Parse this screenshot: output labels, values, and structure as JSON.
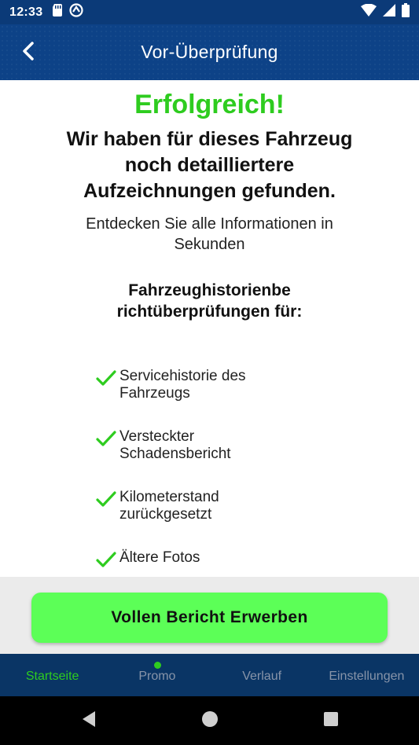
{
  "status_bar": {
    "time": "12:33",
    "left_icons": [
      "sd-card-icon",
      "sync-icon"
    ],
    "right_icons": [
      "wifi-icon",
      "signal-icon",
      "battery-icon"
    ]
  },
  "app_bar": {
    "title": "Vor-Überprüfung",
    "back_icon": "chevron-left-icon"
  },
  "content": {
    "success_title": "Erfolgreich!",
    "headline": "Wir haben für dieses Fahrzeug noch detailliertere Aufzeichnungen gefunden.",
    "subline": "Entdecken Sie alle Informationen in Sekunden",
    "checks_heading": "Fahrzeughistorienbe richtüberprüfungen für:",
    "features": [
      "Servicehistorie des Fahrzeugs",
      "Versteckter Schadensbericht",
      "Kilometerstand zurückgesetzt",
      "Ältere Fotos"
    ]
  },
  "cta": {
    "label": "Vollen Bericht Erwerben"
  },
  "bottom_nav": {
    "items": [
      {
        "label": "Startseite",
        "active": true
      },
      {
        "label": "Promo",
        "active": false,
        "badge_dot": true
      },
      {
        "label": "Verlauf",
        "active": false
      },
      {
        "label": "Einstellungen",
        "active": false
      }
    ]
  },
  "colors": {
    "primary_blue": "#0d4287",
    "nav_blue": "#0a3565",
    "accent_green": "#2ecc1f",
    "button_green": "#5cff57"
  }
}
